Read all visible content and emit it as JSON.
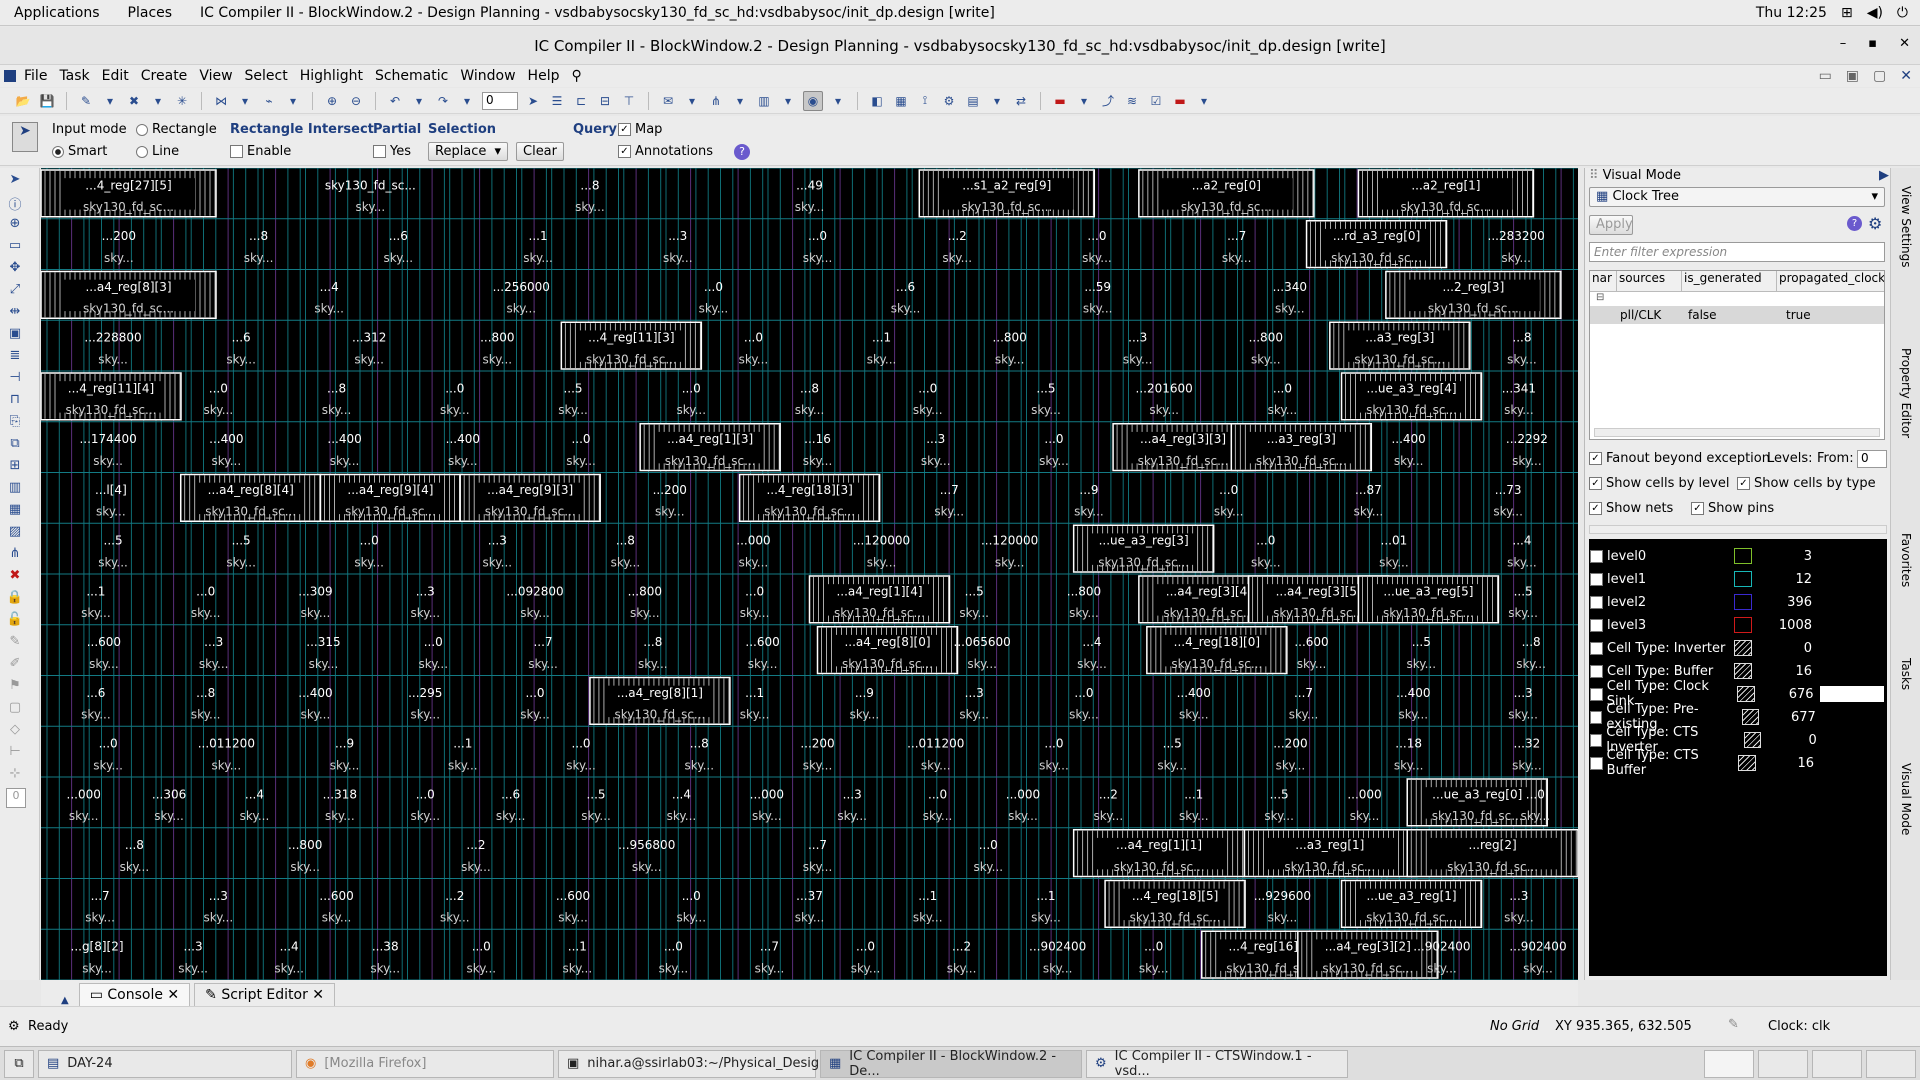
{
  "system_bar": {
    "applications": "Applications",
    "places": "Places",
    "window_name": "IC Compiler II - BlockWindow.2 - Design Planning - vsdbabysocsky130_fd_sc_hd:vsdbabysoc/init_dp.design [write]",
    "clock": "Thu 12:25"
  },
  "window": {
    "title": "IC Compiler II - BlockWindow.2 - Design Planning - vsdbabysocsky130_fd_sc_hd:vsdbabysoc/init_dp.design [write]"
  },
  "menu": [
    "File",
    "Task",
    "Edit",
    "Create",
    "View",
    "Select",
    "Highlight",
    "Schematic",
    "Window",
    "Help"
  ],
  "toolbar": {
    "zoom_value": "0"
  },
  "options": {
    "input_mode_label": "Input mode",
    "rectangle": "Rectangle",
    "smart": "Smart",
    "line": "Line",
    "rect_intersect_label": "Rectangle Intersect",
    "enable": "Enable",
    "partial_label": "Partial",
    "yes": "Yes",
    "selection_label": "Selection",
    "selection_value": "Replace",
    "clear": "Clear",
    "query_label": "Query",
    "map": "Map",
    "annotations": "Annotations"
  },
  "canvas": {
    "rows": [
      [
        "...4_reg[27][5]",
        "sky130_fd_sc...",
        "...8",
        "...49",
        "...s1_a2_reg[9]",
        "...a2_reg[0]",
        "...a2_reg[1]"
      ],
      [
        "...200",
        "...8",
        "...6",
        "...1",
        "...3",
        "...0",
        "...2",
        "...0",
        "...7",
        "...rd_a3_reg[0]",
        "...283200"
      ],
      [
        "...a4_reg[8][3]",
        "...4",
        "...256000",
        "...0",
        "...6",
        "...59",
        "...340",
        "...2_reg[3]"
      ],
      [
        "...228800",
        "...6",
        "...312",
        "...800",
        "...4_reg[11][3]",
        "...0",
        "...1",
        "...800",
        "...3",
        "...800",
        "...a3_reg[3]",
        "...8"
      ],
      [
        "...4_reg[11][4]",
        "...0",
        "...8",
        "...0",
        "...5",
        "...0",
        "...8",
        "...0",
        "...5",
        "...201600",
        "...0",
        "...ue_a3_reg[4]",
        "...341"
      ],
      [
        "...174400",
        "...400",
        "...400",
        "...400",
        "...0",
        "...a4_reg[1][3]",
        "...16",
        "...3",
        "...0",
        "...a4_reg[3][3]",
        "...a3_reg[3]",
        "...400",
        "...2292"
      ],
      [
        "...l[4]",
        "...a4_reg[8][4]",
        "...a4_reg[9][4]",
        "...a4_reg[9][3]",
        "...200",
        "...4_reg[18][3]",
        "...7",
        "...9",
        "...0",
        "...87",
        "...73"
      ],
      [
        "...5",
        "...5",
        "...0",
        "...3",
        "...8",
        "...000",
        "...120000",
        "...120000",
        "...ue_a3_reg[3]",
        "...0",
        "...01",
        "...4"
      ],
      [
        "...1",
        "...0",
        "...309",
        "...3",
        "...092800",
        "...800",
        "...0",
        "...a4_reg[1][4]",
        "...5",
        "...800",
        "...a4_reg[3][4]",
        "...a4_reg[3][5]",
        "...ue_a3_reg[5]",
        "...5"
      ],
      [
        "...600",
        "...3",
        "...315",
        "...0",
        "...7",
        "...8",
        "...600",
        "...a4_reg[8][0]",
        "...065600",
        "...4",
        "...4_reg[18][0]",
        "...600",
        "...5",
        "...8"
      ],
      [
        "...6",
        "...8",
        "...400",
        "...295",
        "...0",
        "...a4_reg[8][1]",
        "...1",
        "...9",
        "...3",
        "...0",
        "...400",
        "...7",
        "...400",
        "...3"
      ],
      [
        "...0",
        "...011200",
        "...9",
        "...1",
        "...0",
        "...8",
        "...200",
        "...011200",
        "...0",
        "...5",
        "...200",
        "...18",
        "...32"
      ],
      [
        "...000",
        "...306",
        "...4",
        "...318",
        "...0",
        "...6",
        "...5",
        "...4",
        "...000",
        "...3",
        "...0",
        "...000",
        "...2",
        "...1",
        "...5",
        "...000",
        "...ue_a3_reg[0]",
        "...0"
      ],
      [
        "...8",
        "...800",
        "...2",
        "...956800",
        "...7",
        "...0",
        "...a4_reg[1][1]",
        "...a3_reg[1]",
        "...reg[2]"
      ],
      [
        "...7",
        "...3",
        "...600",
        "...2",
        "...600",
        "...0",
        "...37",
        "...1",
        "...1",
        "...4_reg[18][5]",
        "...929600",
        "...ue_a3_reg[1]",
        "...3"
      ],
      [
        "...g[8][2]",
        "...3",
        "...4",
        "...38",
        "...0",
        "...1",
        "...0",
        "...7",
        "...0",
        "...2",
        "...902400",
        "...0",
        "...4_reg[16][4]",
        "...a4_reg[3][2]",
        "...902400",
        "...902400"
      ]
    ],
    "sky_short": "sky...",
    "cell_lib": "sky130_fd_sc..."
  },
  "visual_panel": {
    "title": "Visual Mode",
    "mode": "Clock Tree",
    "apply": "Apply",
    "filter_placeholder": "Enter filter expression",
    "columns": [
      "nar",
      "sources",
      "is_generated",
      "propagated_clock"
    ],
    "row": {
      "sources": "pll/CLK",
      "is_generated": "false",
      "propagated_clock": "true"
    },
    "fanout": "Fanout beyond exception",
    "levels_label": "Levels:",
    "from_label": "From:",
    "from_value": "0",
    "show_cells_level": "Show cells by level",
    "show_cells_type": "Show cells by type",
    "show_nets": "Show nets",
    "show_pins": "Show pins",
    "legend": [
      {
        "name": "level0",
        "color": "#7fbf2a",
        "count": "3",
        "checked": false
      },
      {
        "name": "level1",
        "color": "#18b7b7",
        "count": "12",
        "checked": false
      },
      {
        "name": "level2",
        "color": "#3a2ad0",
        "count": "396",
        "checked": false
      },
      {
        "name": "level3",
        "color": "#d01a1a",
        "count": "1008",
        "checked": false
      },
      {
        "name": "Cell Type: Inverter",
        "color": "#ffffff",
        "count": "0",
        "checked": false
      },
      {
        "name": "Cell Type: Buffer",
        "color": "#ffffff",
        "count": "16",
        "checked": false
      },
      {
        "name": "Cell Type: Clock Sink",
        "color": "#ffffff",
        "count": "676",
        "checked": true
      },
      {
        "name": "Cell Type: Pre-existing",
        "color": "#ffffff",
        "count": "677",
        "checked": false
      },
      {
        "name": "Cell Type: CTS Inverter",
        "color": "#ffffff",
        "count": "0",
        "checked": false
      },
      {
        "name": "Cell Type: CTS Buffer",
        "color": "#ffffff",
        "count": "16",
        "checked": false
      }
    ]
  },
  "side_tabs": [
    "View Settings",
    "Property Editor",
    "Favorites",
    "Tasks",
    "Visual Mode"
  ],
  "bottom_tabs": [
    "Console",
    "Script Editor"
  ],
  "status": {
    "ready": "Ready",
    "grid": "No Grid",
    "xy": "XY 935.365, 632.505",
    "clock": "Clock: clk"
  },
  "taskbar": [
    {
      "label": "DAY-24",
      "state": "normal"
    },
    {
      "label": "[Mozilla Firefox]",
      "state": "dim"
    },
    {
      "label": "nihar.a@ssirlab03:~/Physical_Design...",
      "state": "normal"
    },
    {
      "label": "IC Compiler II - BlockWindow.2 - De...",
      "state": "active"
    },
    {
      "label": "IC Compiler II - CTSWindow.1 - vsd...",
      "state": "normal"
    }
  ]
}
